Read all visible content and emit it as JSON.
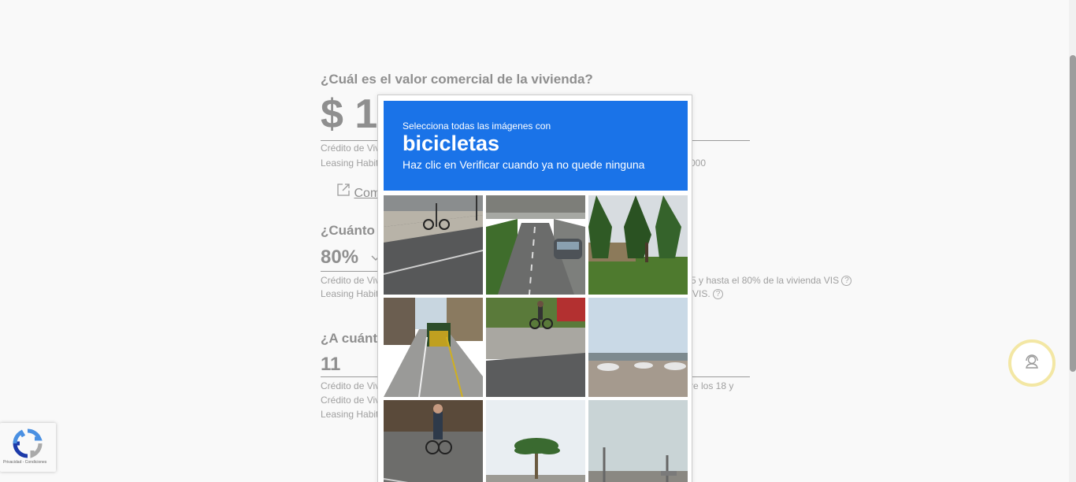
{
  "form": {
    "q1": "¿Cuál es el valor comercial de la vivienda?",
    "value": "$ 1",
    "note1a": "Crédito de Viv",
    "note1b": "Leasing Habit",
    "note1c": "000",
    "ext_link": "Com",
    "q2": "¿Cuánto d",
    "percent": "80%",
    "note2a": "Crédito de Viv",
    "note2b": "Leasing Habit",
    "note2c": "5 y hasta el 80% de la vivienda VIS",
    "note2d": "VIS.",
    "q3": "¿A cuánto",
    "years": "11",
    "note3a": "Crédito de Viv",
    "note3b": "Crédito de Viv",
    "note3c": "Leasing Habit",
    "note3d": "re los 18 y",
    "help_glyph": "?"
  },
  "captcha": {
    "instruction": "Selecciona todas las imágenes con",
    "keyword": "bicicletas",
    "hint": "Haz clic en Verificar cuando ya no quede ninguna"
  },
  "recaptcha_badge": {
    "terms": "Privacidad - Condiciones"
  },
  "icons": {
    "support": "headset-user-icon",
    "recaptcha": "recaptcha-logo-icon",
    "external": "external-link-icon",
    "dropdown": "chevron-down-icon"
  }
}
